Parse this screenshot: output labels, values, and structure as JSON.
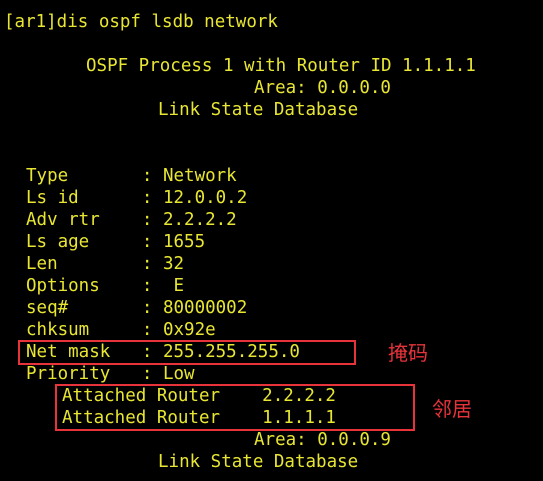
{
  "terminal": {
    "command_line": "[ar1]dis ospf lsdb network",
    "process_line": "OSPF Process 1 with Router ID 1.1.1.1",
    "area_line": "Area: 0.0.0.0",
    "db_title": "Link State Database",
    "fields": {
      "type": "Type       : Network",
      "ls_id": "Ls id      : 12.0.0.2",
      "adv_rtr": "Adv rtr    : 2.2.2.2",
      "ls_age": "Ls age     : 1655",
      "len": "Len        : 32",
      "options": "Options    :  E",
      "seq": "seq#       : 80000002",
      "chksum": "chksum     : 0x92e",
      "net_mask": "Net mask   : 255.255.255.0",
      "priority": "Priority   : Low"
    },
    "attached": [
      "Attached Router    2.2.2.2",
      "Attached Router    1.1.1.1"
    ],
    "area_line_2": "Area: 0.0.0.9",
    "db_title_2": "Link State Database"
  },
  "annotations": {
    "mask_label": "掩码",
    "neighbor_label": "邻居",
    "highlight_color": "#e8333a",
    "text_color": "#e8e633",
    "background": "#000000"
  }
}
